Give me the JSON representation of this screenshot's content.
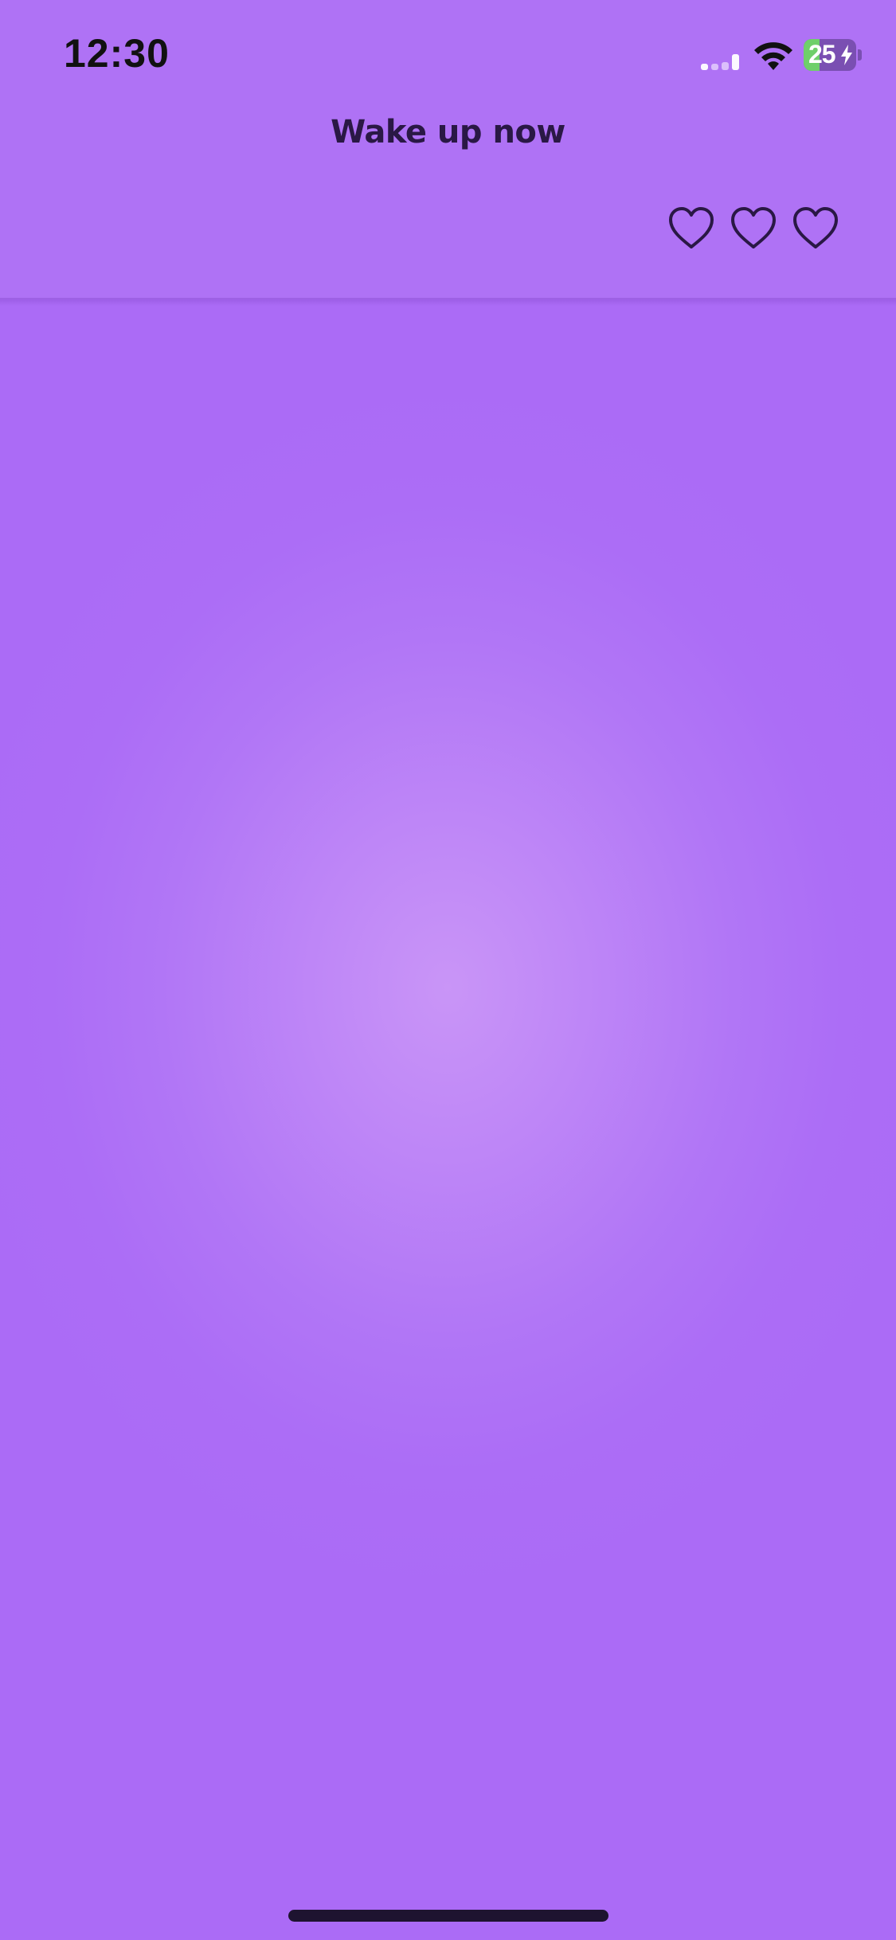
{
  "status_bar": {
    "time": "12:30",
    "signal_icon": "cellular-signal-icon",
    "signal_bars_active": 1,
    "wifi_icon": "wifi-icon",
    "battery_level": "25",
    "battery_fraction": 0.25,
    "charging_icon": "bolt-icon"
  },
  "header": {
    "title": "Wake up now",
    "hearts": [
      {
        "icon": "heart-outline-icon"
      },
      {
        "icon": "heart-outline-icon"
      },
      {
        "icon": "heart-outline-icon"
      }
    ]
  },
  "colors": {
    "background": "#ac6df6",
    "center_glow": "#c995f7",
    "title_text": "#2a1845",
    "battery_green": "#6fcf6a"
  }
}
